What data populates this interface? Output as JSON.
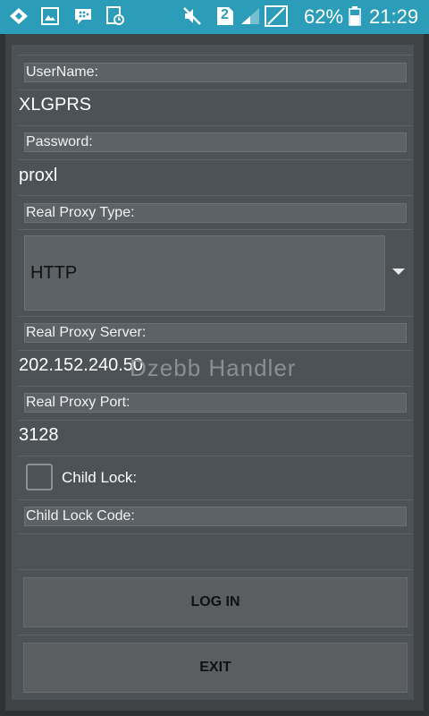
{
  "status_bar": {
    "icons": [
      "signal-sync-icon",
      "image-icon",
      "bbm-icon",
      "clipboard-clock-icon",
      "mute-icon",
      "sim-2-icon",
      "signal-strength-icon",
      "no-signal-icon",
      "battery-icon"
    ],
    "sim_badge": "2",
    "battery_percent": "62%",
    "time": "21:29",
    "background_color": "#2b9db8"
  },
  "form": {
    "username": {
      "label": "UserName:",
      "value": "XLGPRS"
    },
    "password": {
      "label": "Password:",
      "value": "proxl"
    },
    "proxy_type": {
      "label": "Real Proxy Type:",
      "selected": "HTTP"
    },
    "proxy_server": {
      "label": "Real Proxy Server:",
      "value": "202.152.240.50"
    },
    "proxy_port": {
      "label": "Real Proxy Port:",
      "value": "3128"
    },
    "child_lock": {
      "label": "Child Lock:",
      "checked": false
    },
    "child_lock_code": {
      "label": "Child Lock Code:",
      "value": ""
    }
  },
  "watermark": "Dzebb  Handler",
  "buttons": {
    "login": "LOG IN",
    "exit": "EXIT"
  }
}
